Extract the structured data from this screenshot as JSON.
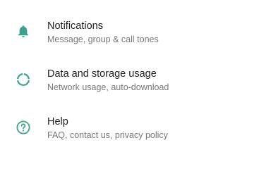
{
  "theme": {
    "icon_color": "#3aa38f",
    "title_color": "#1f1f1f",
    "subtitle_color": "#777777"
  },
  "settings": {
    "items": [
      {
        "icon": "bell-icon",
        "title": "Notifications",
        "subtitle": "Message, group & call tones"
      },
      {
        "icon": "data-usage-icon",
        "title": "Data and storage usage",
        "subtitle": "Network usage, auto-download"
      },
      {
        "icon": "help-icon",
        "title": "Help",
        "subtitle": "FAQ, contact us, privacy policy"
      }
    ]
  }
}
